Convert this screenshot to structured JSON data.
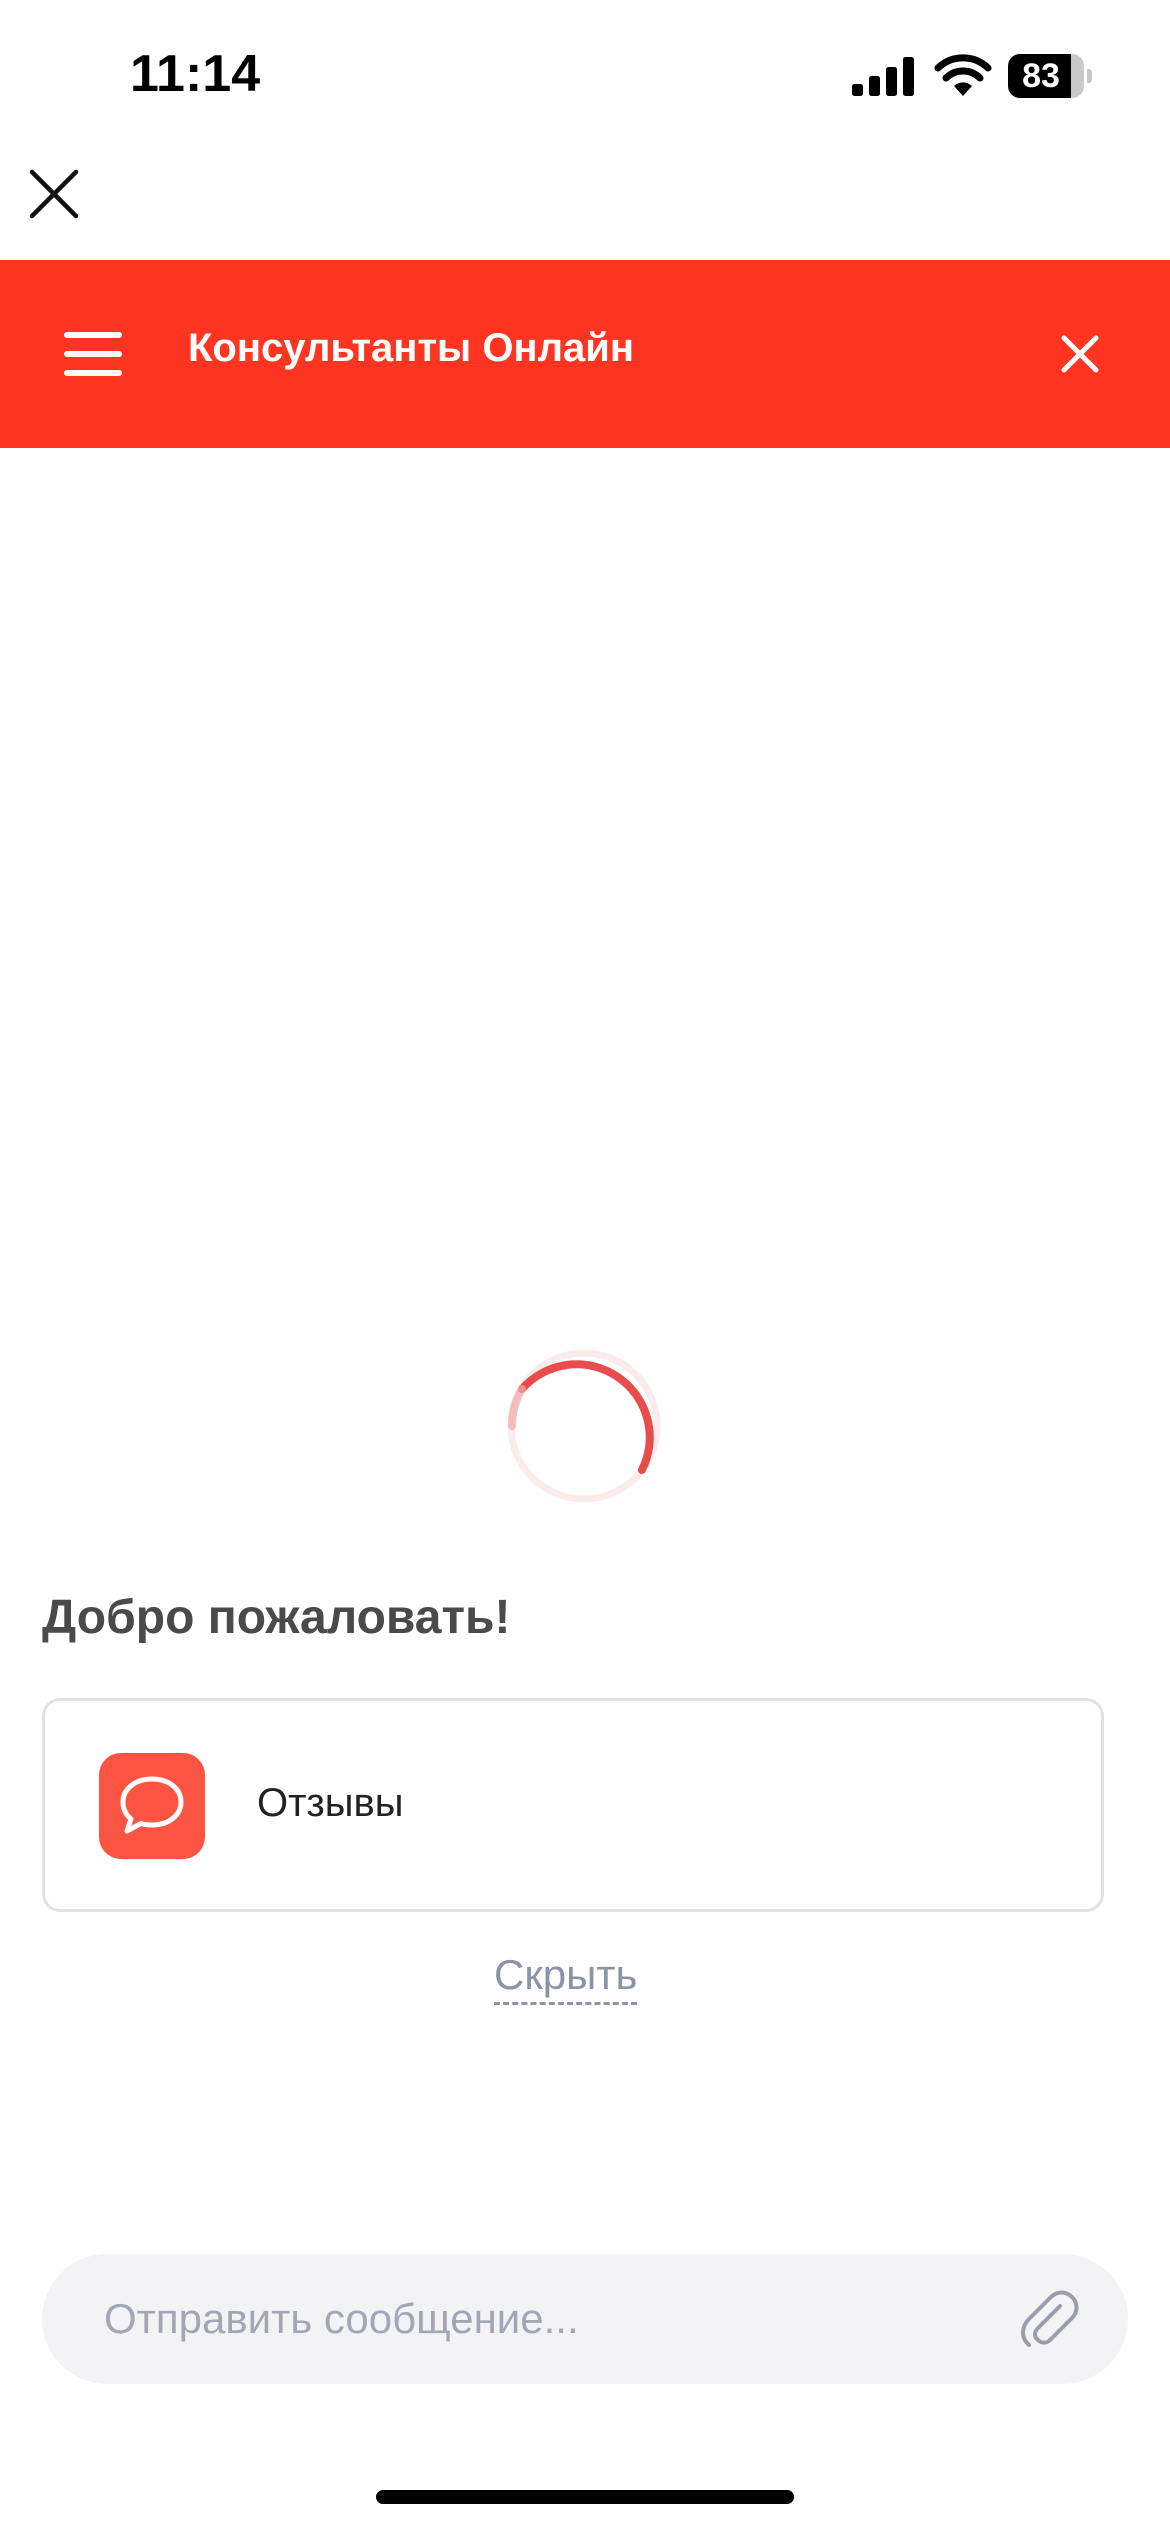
{
  "status_bar": {
    "time": "11:14",
    "battery_level": "83",
    "battery_fraction": 0.83
  },
  "header": {
    "title": "Консультанты Онлайн",
    "background_color": "#ff3421",
    "menu_icon": "hamburger-menu-icon",
    "close_icon": "close-icon"
  },
  "loading": {
    "spinner_icon": "loading-spinner-icon",
    "color": "#e53a3a"
  },
  "welcome": {
    "title": "Добро пожаловать!"
  },
  "options": [
    {
      "label": "Отзывы",
      "icon": "speech-bubble-icon",
      "icon_color": "#fc5443"
    }
  ],
  "hide_link": "Скрыть",
  "message_input": {
    "placeholder": "Отправить сообщение...",
    "value": "",
    "attach_icon": "paperclip-icon"
  }
}
